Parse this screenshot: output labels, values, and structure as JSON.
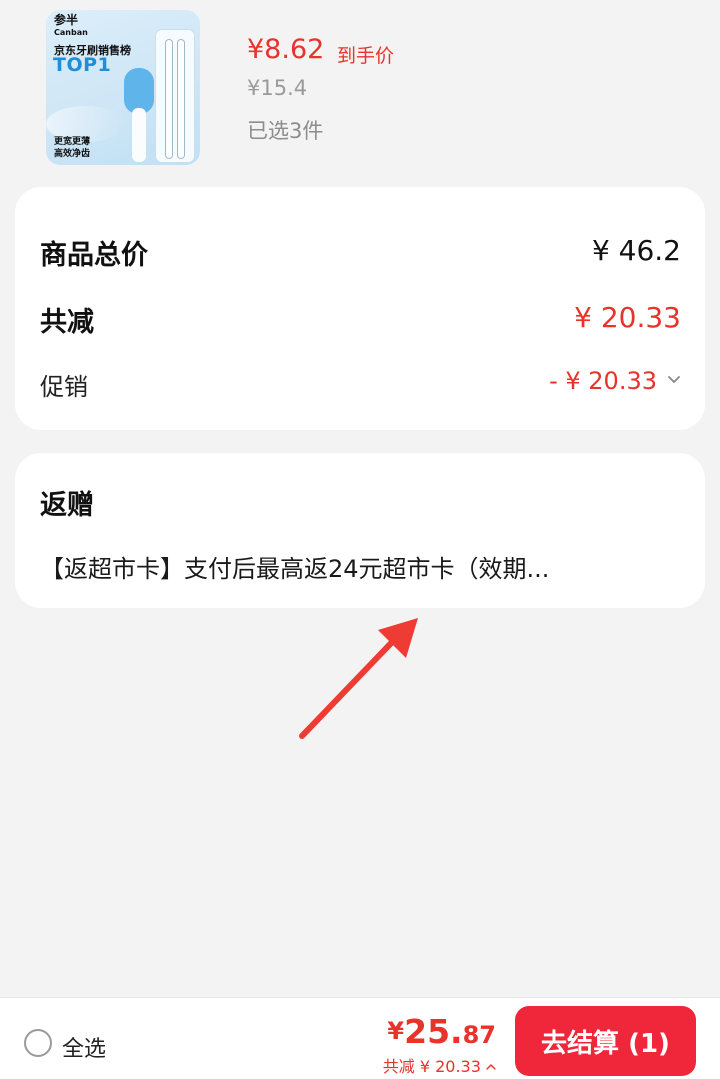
{
  "product": {
    "brand": "参半",
    "brand_en": "Canban",
    "rank_text": "京东牙刷销售榜",
    "rank_badge": "TOP1",
    "slogan_line1": "更宽更薄",
    "slogan_line2": "高效净齿",
    "price": "¥8.62",
    "price_tag": "到手价",
    "original_price": "¥15.4",
    "selected_count": "已选3件"
  },
  "summary": {
    "goods_total_label": "商品总价",
    "goods_total_value": "¥ 46.2",
    "discount_label": "共减",
    "discount_value": "¥ 20.33",
    "promo_label": "促销",
    "promo_value": "- ¥ 20.33"
  },
  "gift": {
    "title": "返赠",
    "description": "【返超市卡】支付后最高返24元超市卡（效期..."
  },
  "bottom_bar": {
    "select_all_label": "全选",
    "total_currency": "¥",
    "total_integer": "25.",
    "total_decimal": "87",
    "saving_text": "共减 ¥ 20.33",
    "checkout_label": "去结算 (1)"
  },
  "colors": {
    "accent_red": "#e8322a",
    "checkout_red": "#f0263a",
    "background": "#f3f3f3"
  },
  "icons": {
    "promo_chevron": "chevron-down-icon",
    "saving_chevron": "chevron-up-icon",
    "select_radio": "radio-unchecked-icon",
    "annotation": "arrow-icon"
  }
}
